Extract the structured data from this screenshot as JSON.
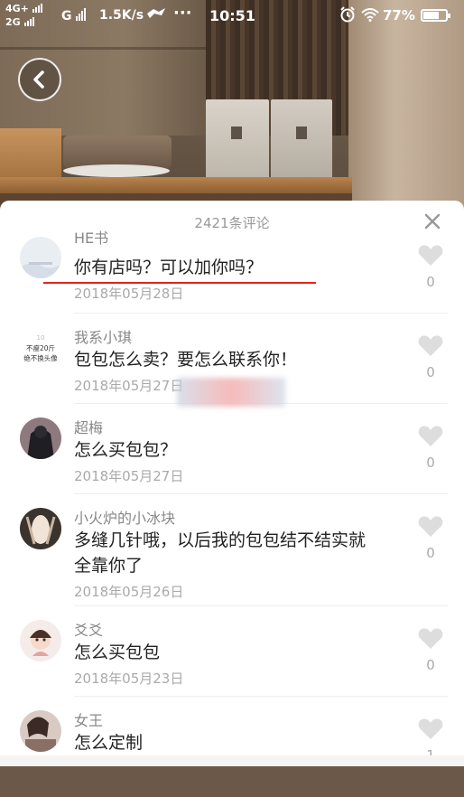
{
  "status_bar": {
    "network_top": "4G+",
    "network_bottom": "2G",
    "network_g": "G",
    "speed": "1.5K/s",
    "time": "10:51",
    "battery": "77%",
    "battery_level": 0.77
  },
  "header": {
    "comment_count_title": "2421条评论"
  },
  "comments": [
    {
      "author": "HE书",
      "text": "你有店吗？可以加你吗？",
      "date": "2018年05月28日",
      "likes": "0"
    },
    {
      "author": "我系小琪",
      "text": "包包怎么卖？要怎么联系你！",
      "date": "2018年05月27日",
      "likes": "0",
      "avatar_text_top": "不瘦20斤",
      "avatar_text_bottom": "绝不换头像"
    },
    {
      "author": "超梅",
      "text": "怎么买包包？",
      "date": "2018年05月27日",
      "likes": "0"
    },
    {
      "author": "小火炉的小冰块",
      "text": "多缝几针哦，以后我的包包结不结实就全靠你了",
      "date": "2018年05月26日",
      "likes": "0"
    },
    {
      "author": "爻爻",
      "text": "怎么买包包",
      "date": "2018年05月23日",
      "likes": "0"
    },
    {
      "author": "女王",
      "text": "怎么定制",
      "date": "",
      "likes": "1"
    }
  ],
  "icons": {
    "back": "chevron-left-icon",
    "close": "close-icon",
    "like": "heart-icon",
    "alarm": "alarm-icon",
    "wifi": "wifi-icon",
    "battery": "battery-icon"
  },
  "colors": {
    "underline": "#e2231a",
    "heart": "#dddddd",
    "muted_text": "#aaaaaa"
  }
}
